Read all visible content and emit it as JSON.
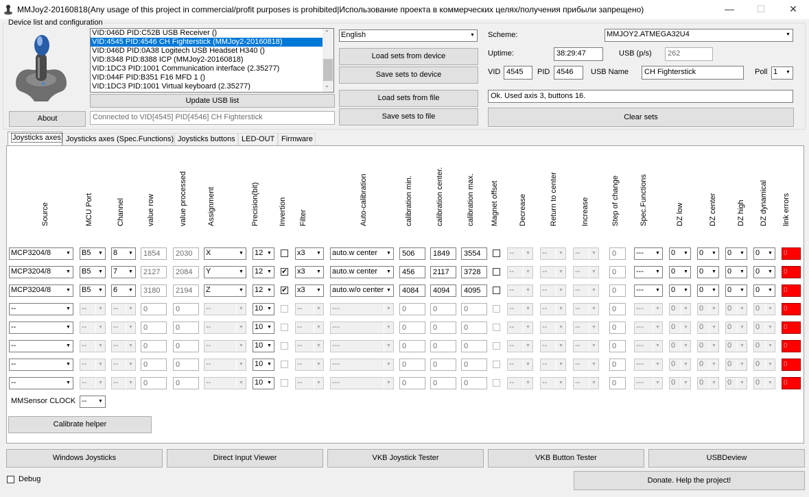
{
  "window": {
    "title": "MMJoy2-20160818(Any usage of this project in commercial/profit purposes is prohibited|Использование проекта в коммерческих целях/получения прибыли запрещено)",
    "min_label": "—",
    "max_label": "☐",
    "close_label": "✕"
  },
  "device_group": {
    "title": "Device list and configuration",
    "about_label": "About",
    "devices": [
      "VID:046D PID:C52B USB Receiver ()",
      "VID:4545 PID:4546 CH Fighterstick (MMJoy2-20160818)",
      "VID:046D PID:0A38 Logitech USB Headset H340 ()",
      "VID:8348 PID:8388 ICP (MMJoy2-20160818)",
      "VID:1DC3 PID:1001 Communication interface (2.35277)",
      "VID:044F PID:B351 F16 MFD 1 ()",
      "VID:1DC3 PID:1001 Virtual keyboard (2.35277)"
    ],
    "update_usb_label": "Update USB list",
    "connected_text": "Connected to VID[4545] PID[4546] CH Fighterstick",
    "language": "English",
    "load_device_label": "Load sets from device",
    "save_device_label": "Save sets to device",
    "load_file_label": "Load sets from file",
    "save_file_label": "Save sets to file",
    "scheme_label": "Scheme:",
    "scheme_value": "MMJOY2.ATMEGA32U4",
    "uptime_label": "Uptime:",
    "uptime_value": "38:29:47",
    "usb_ps_label": "USB (p/s)",
    "usb_ps_value": "262",
    "vid_label": "VID",
    "vid_value": "4545",
    "pid_label": "PID",
    "pid_value": "4546",
    "usb_name_label": "USB Name",
    "usb_name_value": "CH Fighterstick",
    "poll_label": "Poll",
    "poll_value": "1",
    "status_text": "Ok. Used axis  3, buttons 16.",
    "clear_sets_label": "Clear sets"
  },
  "tabs": [
    "Joysticks axes",
    "Joysticks axes (Spec.Functions)",
    "Joysticks buttons",
    "LED-OUT",
    "Firmware"
  ],
  "axes": {
    "headers": [
      "Source",
      "MCU Port",
      "Channel",
      "value row",
      "value processed",
      "Assignment",
      "Precision(bit)",
      "Invertion",
      "Filter",
      "Auto-calibration",
      "calibration min.",
      "calibration center.",
      "calibration max.",
      "Magnet offset",
      "Decrease",
      "Return to center",
      "Increase",
      "Step of change",
      "Spec.Functions",
      "DZ low",
      "DZ center",
      "DZ high",
      "DZ dynamical",
      "link errors"
    ],
    "rows": [
      {
        "source": "MCP3204/8",
        "port": "B5",
        "channel": "8",
        "raw": "1854",
        "processed": "2030",
        "assign": "X",
        "precision": "12",
        "invert": false,
        "filter": "x3",
        "autocal": "auto.w center",
        "cmin": "506",
        "ccenter": "1849",
        "cmax": "3554",
        "magnet": false,
        "decrease": "--",
        "ret": "--",
        "increase": "--",
        "step": "0",
        "spec": "---",
        "dzlow": "0",
        "dzcenter": "0",
        "dzhigh": "0",
        "dzdyn": "0",
        "err": "0"
      },
      {
        "source": "MCP3204/8",
        "port": "B5",
        "channel": "7",
        "raw": "2127",
        "processed": "2084",
        "assign": "Y",
        "precision": "12",
        "invert": true,
        "filter": "x3",
        "autocal": "auto.w center",
        "cmin": "456",
        "ccenter": "2117",
        "cmax": "3728",
        "magnet": false,
        "decrease": "--",
        "ret": "--",
        "increase": "--",
        "step": "0",
        "spec": "---",
        "dzlow": "0",
        "dzcenter": "0",
        "dzhigh": "0",
        "dzdyn": "0",
        "err": "0"
      },
      {
        "source": "MCP3204/8",
        "port": "B5",
        "channel": "6",
        "raw": "3180",
        "processed": "2194",
        "assign": "Z",
        "precision": "12",
        "invert": true,
        "filter": "x3",
        "autocal": "auto.w/o center",
        "cmin": "4084",
        "ccenter": "4094",
        "cmax": "4095",
        "magnet": false,
        "decrease": "--",
        "ret": "--",
        "increase": "--",
        "step": "0",
        "spec": "---",
        "dzlow": "0",
        "dzcenter": "0",
        "dzhigh": "0",
        "dzdyn": "0",
        "err": "0"
      },
      {
        "source": "--",
        "port": "--",
        "channel": "--",
        "raw": "0",
        "processed": "0",
        "assign": "--",
        "precision": "10",
        "invert": false,
        "filter": "--",
        "autocal": "---",
        "cmin": "0",
        "ccenter": "0",
        "cmax": "0",
        "magnet": false,
        "decrease": "--",
        "ret": "--",
        "increase": "--",
        "step": "0",
        "spec": "---",
        "dzlow": "0",
        "dzcenter": "0",
        "dzhigh": "0",
        "dzdyn": "0",
        "err": "0"
      },
      {
        "source": "--",
        "port": "--",
        "channel": "--",
        "raw": "0",
        "processed": "0",
        "assign": "--",
        "precision": "10",
        "invert": false,
        "filter": "--",
        "autocal": "---",
        "cmin": "0",
        "ccenter": "0",
        "cmax": "0",
        "magnet": false,
        "decrease": "--",
        "ret": "--",
        "increase": "--",
        "step": "0",
        "spec": "---",
        "dzlow": "0",
        "dzcenter": "0",
        "dzhigh": "0",
        "dzdyn": "0",
        "err": "0"
      },
      {
        "source": "--",
        "port": "--",
        "channel": "--",
        "raw": "0",
        "processed": "0",
        "assign": "--",
        "precision": "10",
        "invert": false,
        "filter": "--",
        "autocal": "---",
        "cmin": "0",
        "ccenter": "0",
        "cmax": "0",
        "magnet": false,
        "decrease": "--",
        "ret": "--",
        "increase": "--",
        "step": "0",
        "spec": "---",
        "dzlow": "0",
        "dzcenter": "0",
        "dzhigh": "0",
        "dzdyn": "0",
        "err": "0"
      },
      {
        "source": "--",
        "port": "--",
        "channel": "--",
        "raw": "0",
        "processed": "0",
        "assign": "--",
        "precision": "10",
        "invert": false,
        "filter": "--",
        "autocal": "---",
        "cmin": "0",
        "ccenter": "0",
        "cmax": "0",
        "magnet": false,
        "decrease": "--",
        "ret": "--",
        "increase": "--",
        "step": "0",
        "spec": "---",
        "dzlow": "0",
        "dzcenter": "0",
        "dzhigh": "0",
        "dzdyn": "0",
        "err": "0"
      },
      {
        "source": "--",
        "port": "--",
        "channel": "--",
        "raw": "0",
        "processed": "0",
        "assign": "--",
        "precision": "10",
        "invert": false,
        "filter": "--",
        "autocal": "---",
        "cmin": "0",
        "ccenter": "0",
        "cmax": "0",
        "magnet": false,
        "decrease": "--",
        "ret": "--",
        "increase": "--",
        "step": "0",
        "spec": "---",
        "dzlow": "0",
        "dzcenter": "0",
        "dzhigh": "0",
        "dzdyn": "0",
        "err": "0"
      }
    ],
    "mmsensor_label": "MMSensor CLOCK",
    "mmsensor_value": "--",
    "calibrate_label": "Calibrate helper"
  },
  "bottom": {
    "buttons": [
      "Windows Joysticks",
      "Direct Input Viewer",
      "VKB Joystick Tester",
      "VKB Button Tester",
      "USBDeview"
    ],
    "debug_label": "Debug",
    "donate_label": "Donate. Help the project!"
  },
  "colors": {
    "accent": "#0078d7",
    "error": "#ff0000"
  }
}
